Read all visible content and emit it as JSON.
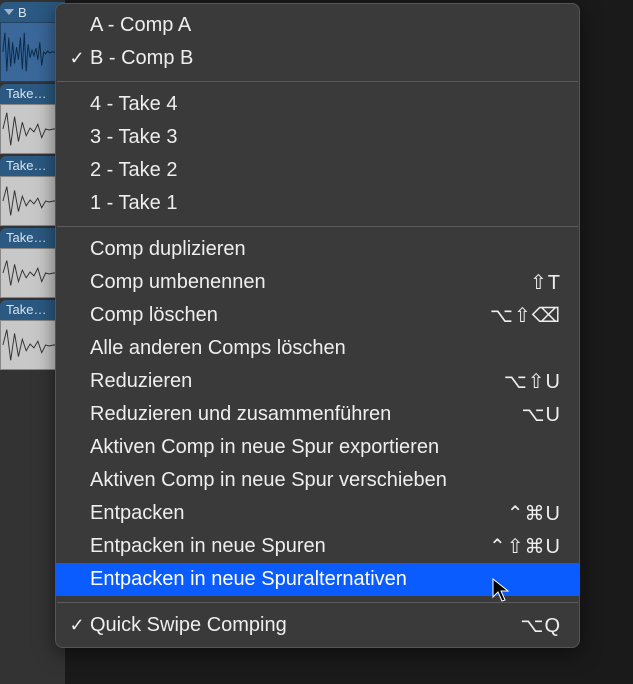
{
  "tracks": {
    "header_label": "B",
    "takes": [
      {
        "label": "Take…"
      },
      {
        "label": "Take…"
      },
      {
        "label": "Take…"
      },
      {
        "label": "Take…"
      }
    ]
  },
  "menu": {
    "groups": [
      {
        "items": [
          {
            "checked": false,
            "label": "A - Comp A",
            "shortcut": ""
          },
          {
            "checked": true,
            "label": "B - Comp B",
            "shortcut": ""
          }
        ]
      },
      {
        "items": [
          {
            "checked": false,
            "label": "4 - Take 4",
            "shortcut": ""
          },
          {
            "checked": false,
            "label": "3 - Take 3",
            "shortcut": ""
          },
          {
            "checked": false,
            "label": "2 - Take 2",
            "shortcut": ""
          },
          {
            "checked": false,
            "label": "1 - Take 1",
            "shortcut": ""
          }
        ]
      },
      {
        "items": [
          {
            "checked": false,
            "label": "Comp duplizieren",
            "shortcut": ""
          },
          {
            "checked": false,
            "label": "Comp umbenennen",
            "shortcut": "⇧T"
          },
          {
            "checked": false,
            "label": "Comp löschen",
            "shortcut": "⌥⇧⌫"
          },
          {
            "checked": false,
            "label": "Alle anderen Comps löschen",
            "shortcut": ""
          },
          {
            "checked": false,
            "label": "Reduzieren",
            "shortcut": "⌥⇧U"
          },
          {
            "checked": false,
            "label": "Reduzieren und zusammenführen",
            "shortcut": "⌥U"
          },
          {
            "checked": false,
            "label": "Aktiven Comp in neue Spur exportieren",
            "shortcut": ""
          },
          {
            "checked": false,
            "label": "Aktiven Comp in neue Spur verschieben",
            "shortcut": ""
          },
          {
            "checked": false,
            "label": "Entpacken",
            "shortcut": "⌃⌘U"
          },
          {
            "checked": false,
            "label": "Entpacken in neue Spuren",
            "shortcut": "⌃⇧⌘U"
          },
          {
            "checked": false,
            "label": "Entpacken in neue Spuralternativen",
            "shortcut": "",
            "highlighted": true
          }
        ]
      },
      {
        "items": [
          {
            "checked": true,
            "label": "Quick Swipe Comping",
            "shortcut": "⌥Q"
          }
        ]
      }
    ]
  }
}
